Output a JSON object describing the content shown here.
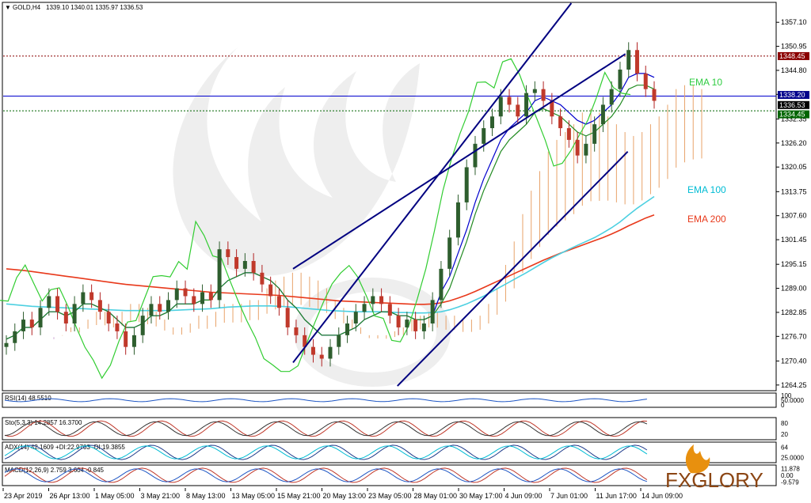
{
  "header": {
    "symbol": "GOLD,H4",
    "ohlc": "1339.10 1340.01 1335.97 1336.53"
  },
  "chart_data": {
    "type": "candlestick",
    "price_axis": {
      "ticks": [
        1357.1,
        1350.95,
        1344.8,
        1338.65,
        1332.35,
        1326.2,
        1320.05,
        1313.75,
        1307.6,
        1301.45,
        1295.15,
        1289.0,
        1282.85,
        1276.7,
        1270.4,
        1264.25
      ],
      "ylim": [
        1263.0,
        1362.0
      ]
    },
    "price_tags": [
      {
        "label": "1348.45",
        "value": 1348.45,
        "color": "#8b0000"
      },
      {
        "label": "1338.20",
        "value": 1338.2,
        "color": "#00008b"
      },
      {
        "label": "1336.53",
        "value": 1336.53,
        "color": "#000000"
      },
      {
        "label": "1334.45",
        "value": 1334.45,
        "color": "#006400"
      }
    ],
    "x_axis": {
      "labels": [
        "23 Apr 2019",
        "26 Apr 13:00",
        "1 May 05:00",
        "3 May 21:00",
        "8 May 13:00",
        "13 May 05:00",
        "15 May 21:00",
        "20 May 13:00",
        "23 May 05:00",
        "28 May 01:00",
        "30 May 17:00",
        "4 Jun 09:00",
        "7 Jun 01:00",
        "11 Jun 17:00",
        "14 Jun 09:00"
      ]
    },
    "ema_labels": [
      {
        "name": "EMA 10",
        "color": "#2ecc40"
      },
      {
        "name": "EMA 100",
        "color": "#00bcd4"
      },
      {
        "name": "EMA 200",
        "color": "#e8391b"
      }
    ],
    "close_series": [
      1275,
      1278,
      1281,
      1279,
      1284,
      1287,
      1283,
      1280,
      1285,
      1288,
      1286,
      1283,
      1280,
      1278,
      1274,
      1277,
      1282,
      1285,
      1283,
      1286,
      1289,
      1287,
      1285,
      1288,
      1286,
      1299,
      1297,
      1294,
      1296,
      1293,
      1290,
      1287,
      1284,
      1279,
      1277,
      1274,
      1272,
      1271,
      1274,
      1277,
      1280,
      1283,
      1285,
      1287,
      1285,
      1282,
      1279,
      1281,
      1278,
      1280,
      1286,
      1294,
      1302,
      1311,
      1320,
      1326,
      1330,
      1333,
      1338,
      1336,
      1333,
      1339,
      1340,
      1337,
      1333,
      1330,
      1327,
      1323,
      1326,
      1331,
      1336,
      1340,
      1345,
      1350,
      1344,
      1340,
      1337
    ],
    "ema10": [
      1276,
      1277,
      1279,
      1279,
      1281,
      1283,
      1283,
      1282,
      1283,
      1285,
      1285,
      1284,
      1283,
      1281,
      1279,
      1279,
      1280,
      1282,
      1282,
      1283,
      1285,
      1285,
      1285,
      1286,
      1286,
      1289,
      1291,
      1292,
      1293,
      1293,
      1292,
      1291,
      1289,
      1286,
      1284,
      1281,
      1279,
      1277,
      1277,
      1277,
      1278,
      1279,
      1281,
      1282,
      1283,
      1283,
      1282,
      1282,
      1281,
      1281,
      1282,
      1285,
      1289,
      1295,
      1301,
      1308,
      1314,
      1319,
      1324,
      1327,
      1329,
      1331,
      1334,
      1335,
      1334,
      1333,
      1331,
      1329,
      1328,
      1329,
      1331,
      1333,
      1336,
      1340,
      1341,
      1341,
      1340
    ],
    "ema100": [
      1285,
      1284.8,
      1284.6,
      1284.4,
      1284.3,
      1284.2,
      1284.1,
      1284,
      1283.9,
      1283.8,
      1283.7,
      1283.6,
      1283.5,
      1283.4,
      1283.3,
      1283.3,
      1283.3,
      1283.3,
      1283.3,
      1283.3,
      1283.4,
      1283.5,
      1283.6,
      1283.7,
      1283.8,
      1284,
      1284.2,
      1284.3,
      1284.4,
      1284.5,
      1284.5,
      1284.5,
      1284.4,
      1284.3,
      1284.1,
      1283.9,
      1283.7,
      1283.5,
      1283.3,
      1283.2,
      1283.1,
      1283,
      1283,
      1283,
      1283,
      1282.9,
      1282.8,
      1282.8,
      1282.7,
      1282.7,
      1282.8,
      1283,
      1283.5,
      1284.2,
      1285,
      1286,
      1287,
      1288.2,
      1289.4,
      1290.6,
      1291.8,
      1293,
      1294.3,
      1295.6,
      1296.8,
      1297.9,
      1299,
      1300,
      1301,
      1302,
      1303.2,
      1304.5,
      1306,
      1307.8,
      1309.5,
      1311,
      1312.5
    ],
    "ema200": [
      1294,
      1293.8,
      1293.6,
      1293.3,
      1293,
      1292.7,
      1292.4,
      1292.1,
      1291.8,
      1291.5,
      1291.2,
      1290.9,
      1290.6,
      1290.3,
      1290,
      1289.8,
      1289.6,
      1289.4,
      1289.2,
      1289,
      1288.8,
      1288.6,
      1288.4,
      1288.2,
      1288,
      1287.9,
      1287.8,
      1287.7,
      1287.6,
      1287.5,
      1287.4,
      1287.3,
      1287.2,
      1287,
      1286.8,
      1286.6,
      1286.4,
      1286.2,
      1286,
      1285.8,
      1285.7,
      1285.6,
      1285.5,
      1285.4,
      1285.3,
      1285.2,
      1285.1,
      1285,
      1284.9,
      1284.9,
      1285,
      1285.3,
      1285.8,
      1286.5,
      1287.3,
      1288.2,
      1289.2,
      1290.2,
      1291.2,
      1292.2,
      1293.2,
      1294.2,
      1295.2,
      1296.2,
      1297.1,
      1298,
      1298.8,
      1299.6,
      1300.4,
      1301.2,
      1302,
      1302.9,
      1303.9,
      1305,
      1306,
      1307,
      1307.8
    ],
    "channel_lines": [
      {
        "from": [
          0.375,
          1270
        ],
        "to": [
          0.735,
          1362
        ]
      },
      {
        "from": [
          0.375,
          1294
        ],
        "to": [
          0.805,
          1349
        ]
      },
      {
        "from": [
          0.51,
          1264
        ],
        "to": [
          0.808,
          1324
        ]
      }
    ],
    "indicators": [
      {
        "name": "RSI",
        "header": "RSI(14) 48.5510",
        "levels": [
          "100",
          "50.0000",
          "0"
        ]
      },
      {
        "name": "Stoch",
        "header": "Sto(5,3,3) 14.2857 16.3700",
        "levels": [
          "80",
          "20"
        ]
      },
      {
        "name": "ADX",
        "header": "ADX(14) 42.1609 +DI:22.9703 -DI:19.3855",
        "levels": [
          "64",
          "25.0000"
        ]
      },
      {
        "name": "MACD",
        "header": "MACD(12,26,9) 2.759 3.604 -0.845",
        "levels": [
          "11.878",
          "0.00",
          "-9.579"
        ]
      }
    ]
  },
  "watermark": {
    "brand": "FXGLORY"
  }
}
